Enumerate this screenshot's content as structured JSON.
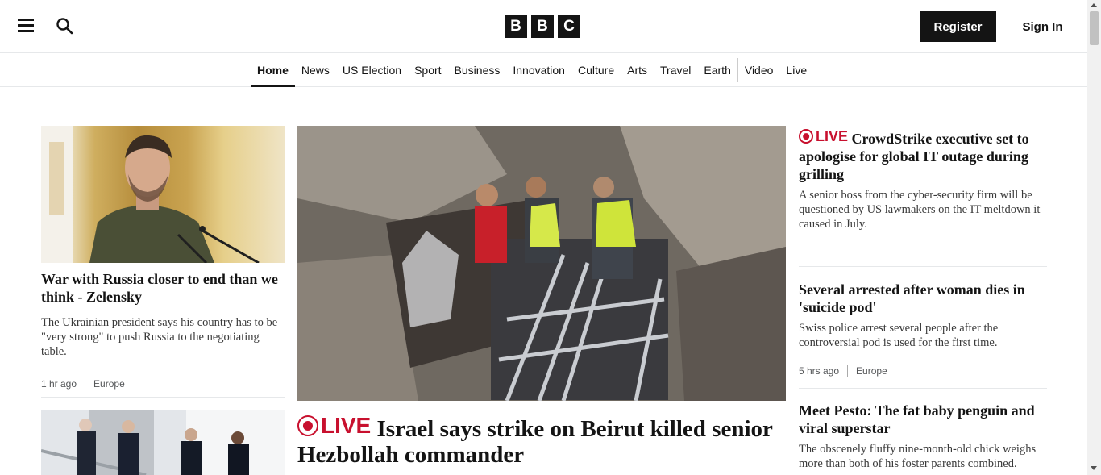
{
  "header": {
    "logo_letters": [
      "B",
      "B",
      "C"
    ],
    "register_label": "Register",
    "signin_label": "Sign In"
  },
  "nav": {
    "items": [
      {
        "label": "Home",
        "active": true
      },
      {
        "label": "News"
      },
      {
        "label": "US Election"
      },
      {
        "label": "Sport"
      },
      {
        "label": "Business"
      },
      {
        "label": "Innovation"
      },
      {
        "label": "Culture"
      },
      {
        "label": "Arts"
      },
      {
        "label": "Travel"
      },
      {
        "label": "Earth"
      },
      {
        "label": "Video"
      },
      {
        "label": "Live"
      }
    ]
  },
  "live_label": "LIVE",
  "left": {
    "story1": {
      "headline": "War with Russia closer to end than we think - Zelensky",
      "summary": "The Ukrainian president says his country has to be \"very strong\" to push Russia to the negotiating table.",
      "time": "1 hr ago",
      "topic": "Europe"
    }
  },
  "center": {
    "headline": "Israel says strike on Beirut killed senior Hezbollah commander"
  },
  "right": {
    "story1": {
      "headline": "CrowdStrike executive set to apologise for global IT outage during grilling",
      "summary": "A senior boss from the cyber-security firm will be questioned by US lawmakers on the IT meltdown it caused in July."
    },
    "story2": {
      "headline": "Several arrested after woman dies in 'suicide pod'",
      "summary": "Swiss police arrest several people after the controversial pod is used for the first time.",
      "time": "5 hrs ago",
      "topic": "Europe"
    },
    "story3": {
      "headline": "Meet Pesto: The fat baby penguin and viral superstar",
      "summary": "The obscenely fluffy nine-month-old chick weighs more than both of his foster parents combined."
    }
  },
  "colors": {
    "live_red": "#c8102e",
    "ink": "#141414",
    "divider": "#e6e8ea"
  },
  "icons": {
    "menu": "hamburger-menu-icon",
    "search": "search-icon",
    "live": "live-record-icon"
  }
}
